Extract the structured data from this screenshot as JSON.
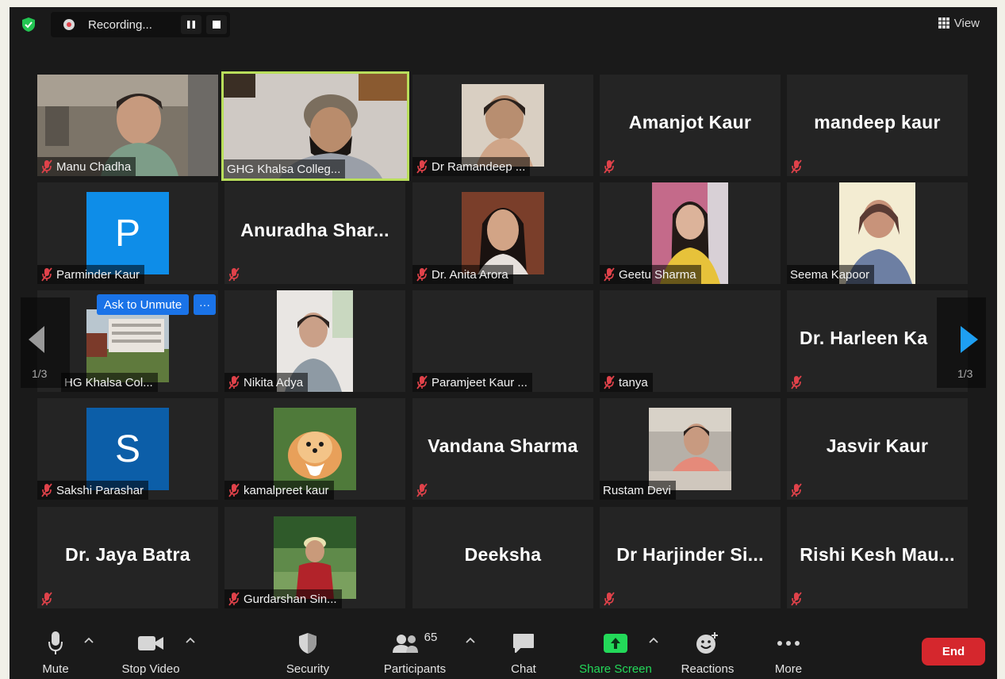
{
  "recording": {
    "label": "Recording..."
  },
  "view": {
    "label": "View"
  },
  "overlay": {
    "ask_to_unmute": "Ask to Unmute",
    "more": "···"
  },
  "pagination": {
    "left": "1/3",
    "right": "1/3"
  },
  "tiles": {
    "manu": {
      "name": "Manu Chadha"
    },
    "ghg": {
      "name": "GHG Khalsa Colleg..."
    },
    "ramandeep": {
      "name": "Dr Ramandeep ..."
    },
    "amanjot": {
      "display": "Amanjot Kaur"
    },
    "mandeep": {
      "display": "mandeep kaur"
    },
    "parminder": {
      "initial": "P",
      "name": "Parminder Kaur"
    },
    "anuradha": {
      "display": "Anuradha  Shar..."
    },
    "anita": {
      "name": "Dr. Anita Arora"
    },
    "geetu": {
      "name": "Geetu Sharma"
    },
    "seema": {
      "name": "Seema Kapoor"
    },
    "hgk": {
      "name": "HG Khalsa Col..."
    },
    "nikita": {
      "name": "Nikita Adya"
    },
    "paramjeet": {
      "name": "Paramjeet Kaur ..."
    },
    "tanya": {
      "name": "tanya"
    },
    "harleen": {
      "display": "Dr. Harleen Ka"
    },
    "sakshi": {
      "initial": "S",
      "name": "Sakshi Parashar"
    },
    "kamalpreet": {
      "name": "kamalpreet kaur"
    },
    "vandana": {
      "display": "Vandana Sharma"
    },
    "rustam": {
      "name": "Rustam Devi"
    },
    "jasvir": {
      "display": "Jasvir Kaur"
    },
    "jaya": {
      "display": "Dr. Jaya Batra"
    },
    "gurdarshan": {
      "name": "Gurdarshan Sin..."
    },
    "deeksha": {
      "display": "Deeksha"
    },
    "harjinder": {
      "display": "Dr Harjinder Si..."
    },
    "rishi": {
      "display": "Rishi  Kesh Mau..."
    }
  },
  "toolbar": {
    "mute": "Mute",
    "stop_video": "Stop Video",
    "security": "Security",
    "participants": "Participants",
    "participants_count": "65",
    "chat": "Chat",
    "share_screen": "Share Screen",
    "reactions": "Reactions",
    "more": "More",
    "end": "End"
  },
  "colors": {
    "background": "#1a1a1a",
    "tile": "#242424",
    "active_speaker": "#b9de5b",
    "share_green": "#23d959",
    "end_red": "#d5272d",
    "accent_blue": "#1a73e8",
    "muted_red": "#e0424a"
  }
}
